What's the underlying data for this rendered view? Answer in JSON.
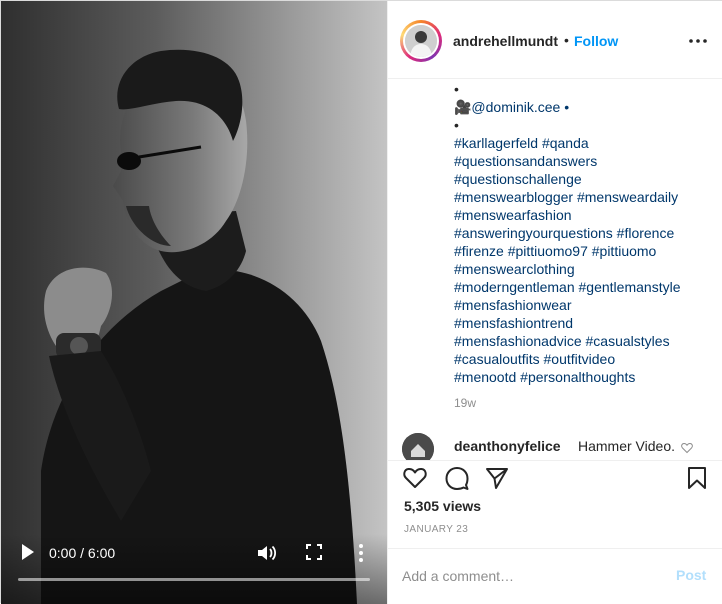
{
  "video": {
    "time": "0:00 / 6:00",
    "progress": 0.0
  },
  "header": {
    "username": "andrehellmundt",
    "separator": "•",
    "follow_label": "Follow"
  },
  "caption": {
    "lines": [
      {
        "text": "•",
        "kind": "text"
      },
      {
        "text": "🎥@dominik.cee •",
        "kind": "mention"
      },
      {
        "text": "•",
        "kind": "text"
      },
      {
        "text": "#karllagerfeld #qanda",
        "kind": "tags"
      },
      {
        "text": "#questionsandanswers",
        "kind": "tags"
      },
      {
        "text": "#questionschallenge",
        "kind": "tags"
      },
      {
        "text": "#menswearblogger #mensweardaily",
        "kind": "tags"
      },
      {
        "text": "#menswearfashion",
        "kind": "tags"
      },
      {
        "text": "#answeringyourquestions #florence",
        "kind": "tags"
      },
      {
        "text": "#firenze #pittiuomo97 #pittiuomo",
        "kind": "tags"
      },
      {
        "text": "#menswearclothing",
        "kind": "tags"
      },
      {
        "text": "#moderngentleman #gentlemanstyle",
        "kind": "tags"
      },
      {
        "text": "#mensfashionwear",
        "kind": "tags"
      },
      {
        "text": "#mensfashiontrend",
        "kind": "tags"
      },
      {
        "text": "#mensfashionadvice #casualstyles",
        "kind": "tags"
      },
      {
        "text": "#casualoutfits #outfitvideo",
        "kind": "tags"
      },
      {
        "text": "#menootd #personalthoughts",
        "kind": "tags"
      }
    ],
    "age": "19w"
  },
  "comment": {
    "user": "deanthonyfelice",
    "text": "Hammer Video."
  },
  "stats": {
    "views": "5,305 views",
    "date": "JANUARY 23"
  },
  "add_comment": {
    "placeholder": "Add a comment…",
    "post_label": "Post"
  },
  "colors": {
    "link": "#00376b",
    "follow": "#0095f6",
    "muted": "#8e8e8e",
    "post_disabled": "#b2dffc"
  },
  "icons": {
    "play": "play-icon",
    "volume": "volume-icon",
    "fullscreen": "fullscreen-icon",
    "video_more": "vertical-dots-icon",
    "options": "horizontal-dots-icon",
    "like": "heart-icon",
    "comment": "speech-bubble-icon",
    "share": "paper-plane-icon",
    "save": "bookmark-icon",
    "comment_like": "small-heart-icon"
  }
}
